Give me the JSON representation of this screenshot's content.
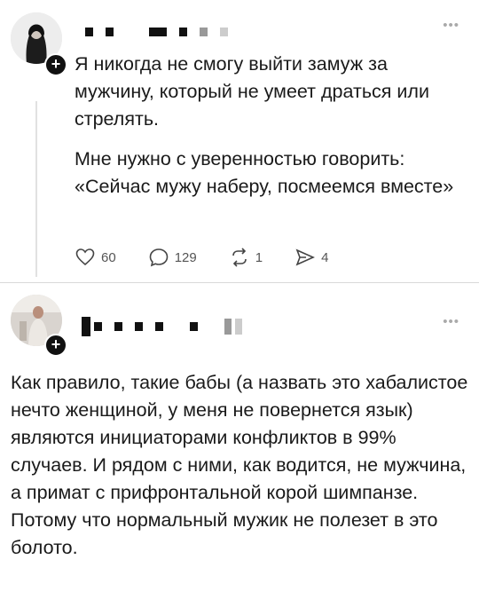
{
  "post1": {
    "author_name_hidden": true,
    "paragraph1": "Я никогда не смогу выйти замуж за мужчину, который не умеет драться или стрелять.",
    "paragraph2": "Мне нужно с уверенностью говорить: «Сейчас мужу наберу, посмеемся вместе»",
    "stats": {
      "likes": "60",
      "comments": "129",
      "reposts": "1",
      "shares": "4"
    }
  },
  "post2": {
    "author_name_hidden": true,
    "paragraph": "Как правило, такие бабы (а назвать это хабалистое нечто женщиной, у меня не повернется язык) являются инициаторами конфликтов в 99% случаев. И рядом с ними, как водится, не мужчина, а примат с прифронтальной корой шимпанзе. Потому что нормальный мужик не полезет в это болото."
  },
  "icons": {
    "follow": "plus-icon",
    "more": "more-horizontal-icon",
    "like": "heart-icon",
    "comment": "comment-bubble-icon",
    "repost": "repost-icon",
    "share": "send-icon"
  }
}
